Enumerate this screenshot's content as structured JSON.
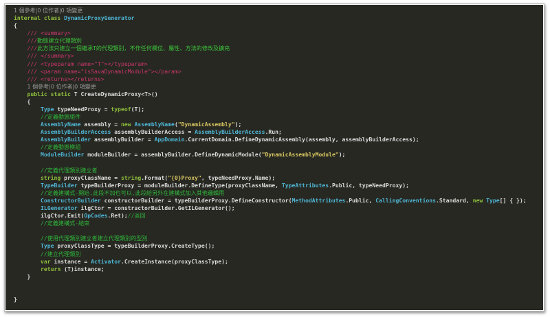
{
  "editor": {
    "theme_colors": {
      "background": "#272822",
      "keyword": "#8fbe3c",
      "type": "#4fb7d6",
      "string": "#d8c762",
      "comment": "#2fb43a",
      "doc_comment": "#c8376b",
      "text": "#dcdcdc",
      "codelens": "#9a9a9a"
    },
    "lines": [
      [
        [
          "lens",
          "1 個參考|0 位作者|0 項變更"
        ]
      ],
      [
        [
          "kw",
          "internal"
        ],
        [
          "tx",
          " "
        ],
        [
          "kw",
          "class"
        ],
        [
          "tx",
          " "
        ],
        [
          "ty",
          "DynamicProxyGenerator"
        ]
      ],
      [
        [
          "tx",
          "{"
        ]
      ],
      [
        [
          "tx",
          "    "
        ],
        [
          "doc",
          "/// <summary>"
        ]
      ],
      [
        [
          "tx",
          "    "
        ],
        [
          "doc",
          "///"
        ],
        [
          "doctext",
          "動態建立代理類別"
        ]
      ],
      [
        [
          "tx",
          "    "
        ],
        [
          "doc",
          "///"
        ],
        [
          "doctext",
          "此方法只建立一個繼承T的代理類別，不作任何欄位、屬性、方法的修改及擴充"
        ]
      ],
      [
        [
          "tx",
          "    "
        ],
        [
          "doc",
          "/// </summary>"
        ]
      ],
      [
        [
          "tx",
          "    "
        ],
        [
          "doc",
          "/// <typeparam name=\"T\"></typeparam>"
        ]
      ],
      [
        [
          "tx",
          "    "
        ],
        [
          "doc",
          "/// <param name=\"isSavaDynamicModule\"></param>"
        ]
      ],
      [
        [
          "tx",
          "    "
        ],
        [
          "doc",
          "/// <returns></returns>"
        ]
      ],
      [
        [
          "tx",
          "    "
        ],
        [
          "lens",
          "1 個參考|0 位作者|0 項變更"
        ]
      ],
      [
        [
          "tx",
          "    "
        ],
        [
          "kw",
          "public"
        ],
        [
          "tx",
          " "
        ],
        [
          "kw",
          "static"
        ],
        [
          "tx",
          " T CreateDynamicProxy<T>()"
        ]
      ],
      [
        [
          "tx",
          "    {"
        ]
      ],
      [
        [
          "tx",
          "        "
        ],
        [
          "ty",
          "Type"
        ],
        [
          "tx",
          " typeNeedProxy = "
        ],
        [
          "kw",
          "typeof"
        ],
        [
          "tx",
          "(T);"
        ]
      ],
      [
        [
          "tx",
          "        "
        ],
        [
          "cm",
          "//定義動態組件"
        ]
      ],
      [
        [
          "tx",
          "        "
        ],
        [
          "ty",
          "AssemblyName"
        ],
        [
          "tx",
          " assembly = "
        ],
        [
          "kw",
          "new"
        ],
        [
          "tx",
          " "
        ],
        [
          "ty",
          "AssemblyName"
        ],
        [
          "tx",
          "("
        ],
        [
          "str",
          "\"DynamicAssembly\""
        ],
        [
          "tx",
          ");"
        ]
      ],
      [
        [
          "tx",
          "        "
        ],
        [
          "ty",
          "AssemblyBuilderAccess"
        ],
        [
          "tx",
          " assemblyBuilderAccess = "
        ],
        [
          "ty",
          "AssemblyBuilderAccess"
        ],
        [
          "tx",
          ".Run;"
        ]
      ],
      [
        [
          "tx",
          "        "
        ],
        [
          "ty",
          "AssemblyBuilder"
        ],
        [
          "tx",
          " assemblyBuilder = "
        ],
        [
          "ty",
          "AppDomain"
        ],
        [
          "tx",
          ".CurrentDomain.DefineDynamicAssembly(assembly, assemblyBuilderAccess);"
        ]
      ],
      [
        [
          "tx",
          "        "
        ],
        [
          "cm",
          "//定義動態模組"
        ]
      ],
      [
        [
          "tx",
          "        "
        ],
        [
          "ty",
          "ModuleBuilder"
        ],
        [
          "tx",
          " moduleBuilder = assemblyBuilder.DefineDynamicModule("
        ],
        [
          "str",
          "\"DynamicAssemblyModule\""
        ],
        [
          "tx",
          ");"
        ]
      ],
      [
        [
          "tx",
          ""
        ]
      ],
      [
        [
          "tx",
          "        "
        ],
        [
          "cm",
          "//定義代理類別建立者"
        ]
      ],
      [
        [
          "tx",
          "        "
        ],
        [
          "kw",
          "string"
        ],
        [
          "tx",
          " proxyClassName = "
        ],
        [
          "kw",
          "string"
        ],
        [
          "tx",
          ".Format("
        ],
        [
          "str",
          "\"{0}Proxy\""
        ],
        [
          "tx",
          ", typeNeedProxy.Name);"
        ]
      ],
      [
        [
          "tx",
          "        "
        ],
        [
          "ty",
          "TypeBuilder"
        ],
        [
          "tx",
          " typeBuilderProxy = moduleBuilder.DefineType(proxyClassName, "
        ],
        [
          "ty",
          "TypeAttributes"
        ],
        [
          "tx",
          ".Public, typeNeedProxy);"
        ]
      ],
      [
        [
          "tx",
          "        "
        ],
        [
          "cm",
          "//定義建構式-開始,此段不加也可以,此段給另外在建構式加入其他邏輯用"
        ]
      ],
      [
        [
          "tx",
          "        "
        ],
        [
          "ty",
          "ConstructorBuilder"
        ],
        [
          "tx",
          " constructorBuilder = typeBuilderProxy.DefineConstructor("
        ],
        [
          "ty",
          "MethodAttributes"
        ],
        [
          "tx",
          ".Public, "
        ],
        [
          "ty",
          "CallingConventions"
        ],
        [
          "tx",
          ".Standard, "
        ],
        [
          "kw",
          "new"
        ],
        [
          "tx",
          " "
        ],
        [
          "ty",
          "Type"
        ],
        [
          "tx",
          "[] { });"
        ]
      ],
      [
        [
          "tx",
          "        "
        ],
        [
          "ty",
          "ILGenerator"
        ],
        [
          "tx",
          " ilgCtor = constructorBuilder.GetILGenerator();"
        ]
      ],
      [
        [
          "tx",
          "        ilgCtor.Emit("
        ],
        [
          "ty",
          "OpCodes"
        ],
        [
          "tx",
          ".Ret);"
        ],
        [
          "cm",
          "//返回"
        ]
      ],
      [
        [
          "tx",
          "        "
        ],
        [
          "cm",
          "//定義建構式-結束"
        ]
      ],
      [
        [
          "tx",
          ""
        ]
      ],
      [
        [
          "tx",
          "        "
        ],
        [
          "cm",
          "//使用代理類別建立者建立代理類別的型別"
        ]
      ],
      [
        [
          "tx",
          "        "
        ],
        [
          "ty",
          "Type"
        ],
        [
          "tx",
          " proxyClassType = typeBuilderProxy.CreateType();"
        ]
      ],
      [
        [
          "tx",
          "        "
        ],
        [
          "cm",
          "//建立代理類別"
        ]
      ],
      [
        [
          "tx",
          "        "
        ],
        [
          "kw",
          "var"
        ],
        [
          "tx",
          " instance = "
        ],
        [
          "ty",
          "Activator"
        ],
        [
          "tx",
          ".CreateInstance(proxyClassType);"
        ]
      ],
      [
        [
          "tx",
          "        "
        ],
        [
          "kw",
          "return"
        ],
        [
          "tx",
          " (T)instance;"
        ]
      ],
      [
        [
          "tx",
          "    }"
        ]
      ],
      [
        [
          "tx",
          ""
        ]
      ],
      [
        [
          "tx",
          ""
        ]
      ],
      [
        [
          "tx",
          "}"
        ]
      ]
    ]
  }
}
